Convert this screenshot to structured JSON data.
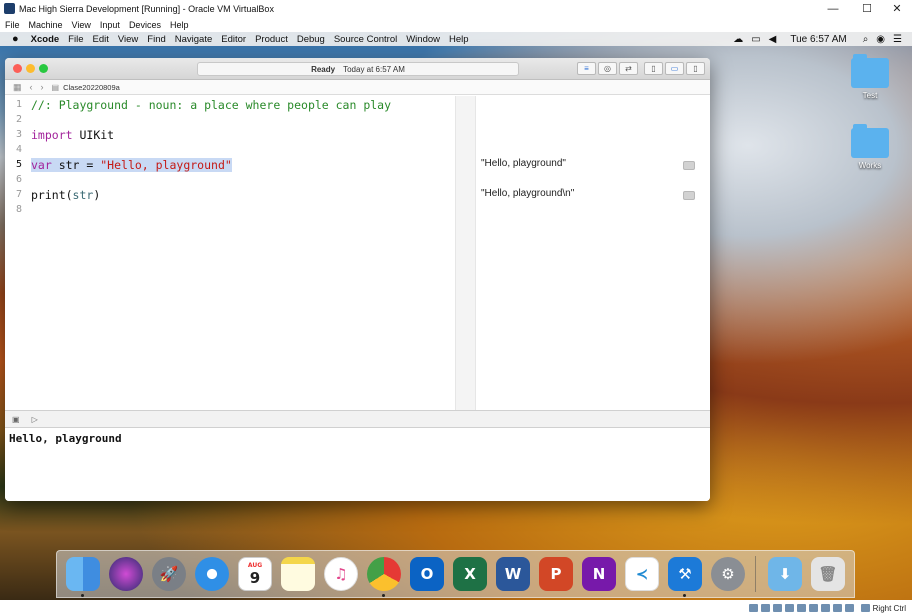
{
  "vbox": {
    "title": "Mac High Sierra Development [Running] - Oracle VM VirtualBox",
    "menu": [
      "File",
      "Machine",
      "View",
      "Input",
      "Devices",
      "Help"
    ],
    "host_key": "Right Ctrl"
  },
  "mac_menubar": {
    "app": "Xcode",
    "items": [
      "File",
      "Edit",
      "View",
      "Find",
      "Navigate",
      "Editor",
      "Product",
      "Debug",
      "Source Control",
      "Window",
      "Help"
    ],
    "clock": "Tue 6:57 AM"
  },
  "desktop": {
    "icons": [
      "Test",
      "Works"
    ]
  },
  "xcode": {
    "activity_status": "Ready",
    "activity_time": "Today at 6:57 AM",
    "file_name": "Clase20220809a",
    "lines": [
      {
        "n": "1",
        "text": "//: Playground - noun: a place where people can play"
      },
      {
        "n": "2",
        "text": ""
      },
      {
        "n": "3",
        "kw": "import",
        "rest": " UIKit"
      },
      {
        "n": "4",
        "text": ""
      },
      {
        "n": "5",
        "kw": "var",
        "mid": " str = ",
        "str": "\"Hello, playground\""
      },
      {
        "n": "6",
        "text": ""
      },
      {
        "n": "7",
        "fn": "print(",
        "arg": "str",
        "close": ")"
      },
      {
        "n": "8",
        "text": ""
      }
    ],
    "results": [
      "\"Hello, playground\"",
      "\"Hello, playground\\n\""
    ],
    "console_output": "Hello, playground"
  },
  "dock": {
    "apps": [
      "Finder",
      "Siri",
      "Launchpad",
      "Safari",
      "Calendar",
      "Notes",
      "iTunes",
      "Chrome",
      "Outlook",
      "Excel",
      "Word",
      "PowerPoint",
      "OneNote",
      "Visual Studio Code",
      "Xcode",
      "System Preferences",
      "Downloads",
      "Trash"
    ],
    "calendar_month": "AUG",
    "calendar_day": "9"
  }
}
